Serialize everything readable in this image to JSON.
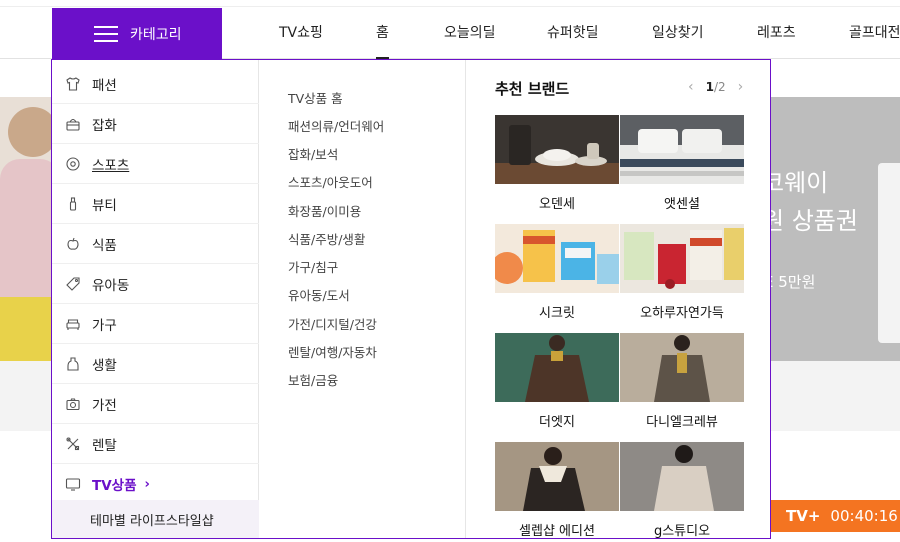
{
  "header": {
    "category_button": "카테고리",
    "nav": [
      "TV쇼핑",
      "홈",
      "오늘의딜",
      "슈퍼핫딜",
      "일상찾기",
      "레포츠",
      "골프대전"
    ],
    "active_nav": "홈"
  },
  "background": {
    "banner_text1": "코웨이",
    "banner_text2": "원 상품권",
    "banner_text3": "E 5만원",
    "tv_label": "TV+",
    "tv_time": "00:40:16"
  },
  "categories": [
    {
      "label": "패션",
      "icon": "tshirt-icon"
    },
    {
      "label": "잡화",
      "icon": "bag-icon"
    },
    {
      "label": "스포츠",
      "icon": "ball-icon"
    },
    {
      "label": "뷰티",
      "icon": "cosmetic-icon"
    },
    {
      "label": "식품",
      "icon": "apple-icon"
    },
    {
      "label": "유아동",
      "icon": "tag-icon"
    },
    {
      "label": "가구",
      "icon": "sofa-icon"
    },
    {
      "label": "생활",
      "icon": "bottle-icon"
    },
    {
      "label": "가전",
      "icon": "camera-icon"
    },
    {
      "label": "렌탈",
      "icon": "tools-icon"
    },
    {
      "label": "TV상품",
      "icon": "tv-icon"
    }
  ],
  "active_category_chevron": "›",
  "subcategory": "테마별 라이프스타일샵",
  "links": [
    "TV상품 홈",
    "패션의류/언더웨어",
    "잡화/보석",
    "스포츠/아웃도어",
    "화장품/이미용",
    "식품/주방/생활",
    "가구/침구",
    "유아동/도서",
    "가전/디지털/건강",
    "렌탈/여행/자동차",
    "보험/금융"
  ],
  "brands_panel": {
    "title": "추천 브랜드",
    "page_current": "1",
    "page_total": "/2",
    "brands": [
      "오덴세",
      "앳센셜",
      "시크릿",
      "오하루자연가득",
      "더엣지",
      "다니엘크레뷰",
      "셀렙샵 에디션",
      "g스튜디오"
    ]
  },
  "colors": {
    "accent": "#6b10c9",
    "tv_bar": "#f47421"
  }
}
